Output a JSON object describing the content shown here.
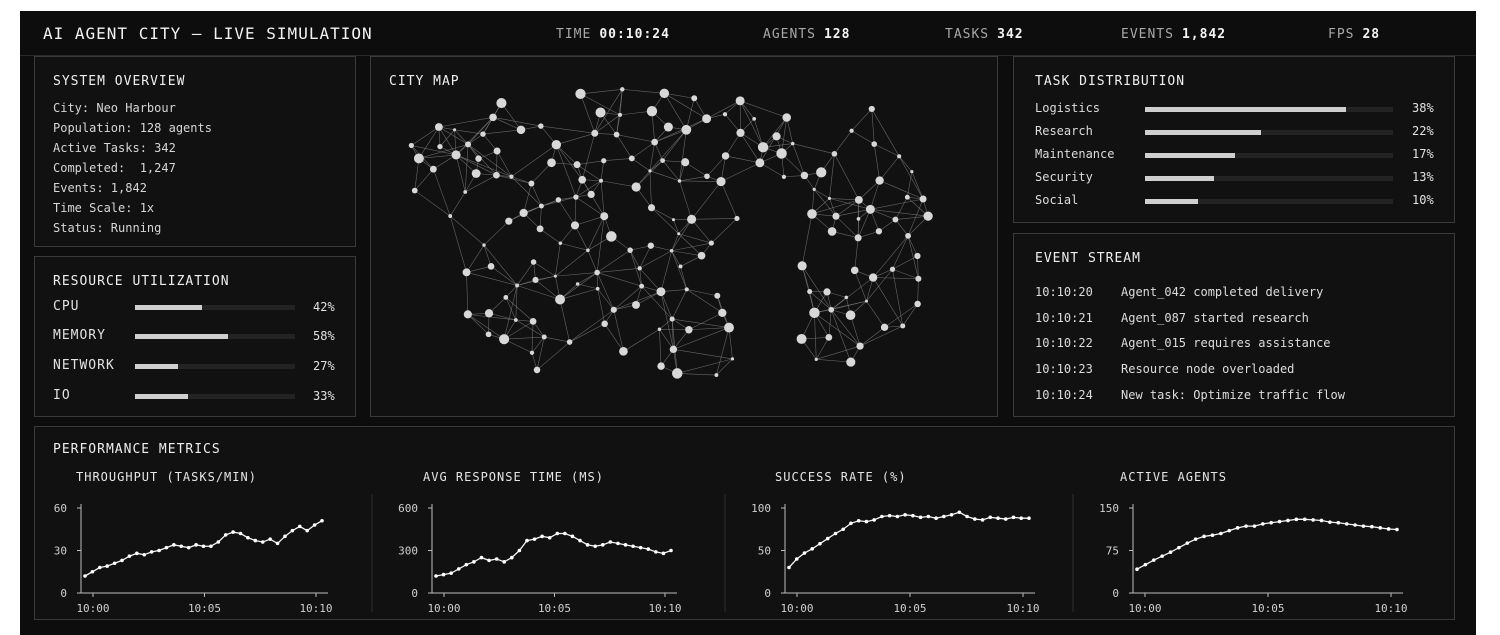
{
  "header": {
    "title": "AI AGENT CITY — LIVE SIMULATION",
    "stats": [
      {
        "label": "TIME",
        "value": "00:10:24"
      },
      {
        "label": "AGENTS",
        "value": "128"
      },
      {
        "label": "TASKS",
        "value": "342"
      },
      {
        "label": "EVENTS",
        "value": "1,842"
      },
      {
        "label": "FPS",
        "value": "28"
      }
    ]
  },
  "system_overview": {
    "title": "SYSTEM OVERVIEW",
    "lines": [
      "City: Neo Harbour",
      "Population: 128 agents",
      "Active Tasks: 342",
      "Completed:  1,247",
      "Events: 1,842",
      "Time Scale: 1x",
      "Status: Running"
    ]
  },
  "resources": {
    "title": "RESOURCE UTILIZATION",
    "items": [
      {
        "label": "CPU",
        "pct": "42%",
        "value": 42
      },
      {
        "label": "MEMORY",
        "pct": "58%",
        "value": 58
      },
      {
        "label": "NETWORK",
        "pct": "27%",
        "value": 27
      },
      {
        "label": "IO",
        "pct": "33%",
        "value": 33
      }
    ]
  },
  "city_map": {
    "title": "CITY MAP"
  },
  "tasks": {
    "title": "TASK DISTRIBUTION",
    "items": [
      {
        "label": "Logistics",
        "pct": "38%",
        "value": 38
      },
      {
        "label": "Research",
        "pct": "22%",
        "value": 22
      },
      {
        "label": "Maintenance",
        "pct": "17%",
        "value": 17
      },
      {
        "label": "Security",
        "pct": "13%",
        "value": 13
      },
      {
        "label": "Social",
        "pct": "10%",
        "value": 10
      }
    ]
  },
  "events": {
    "title": "EVENT STREAM",
    "items": [
      {
        "time": "10:10:20",
        "text": "Agent_042 completed delivery"
      },
      {
        "time": "10:10:21",
        "text": "Agent_087 started research"
      },
      {
        "time": "10:10:22",
        "text": "Agent_015 requires assistance"
      },
      {
        "time": "10:10:23",
        "text": "Resource node overloaded"
      },
      {
        "time": "10:10:24",
        "text": "New task: Optimize traffic flow"
      }
    ]
  },
  "performance": {
    "title": "PERFORMANCE METRICS"
  },
  "colors": {
    "background": "#0d0d0d",
    "panel": "#111111",
    "bar": "#cfcfcf",
    "line": "#f2f2f2"
  },
  "chart_data": [
    {
      "type": "line",
      "title": "THROUGHPUT (TASKS/MIN)",
      "ylim": [
        0,
        60
      ],
      "yticks": [
        "60",
        "30",
        "0"
      ],
      "xticks": [
        "10:00",
        "10:05",
        "10:10"
      ],
      "series": [
        {
          "values": [
            12,
            15,
            18,
            19,
            21,
            23,
            26,
            28,
            27,
            29,
            30,
            32,
            34,
            33,
            32,
            34,
            33,
            33,
            36,
            41,
            43,
            42,
            39,
            37,
            36,
            38,
            35,
            40,
            44,
            47,
            44,
            48,
            51
          ]
        }
      ]
    },
    {
      "type": "line",
      "title": "AVG RESPONSE TIME (MS)",
      "ylim": [
        0,
        600
      ],
      "yticks": [
        "600",
        "300",
        "0"
      ],
      "xticks": [
        "10:00",
        "10:05",
        "10:10"
      ],
      "series": [
        {
          "values": [
            120,
            130,
            140,
            170,
            200,
            220,
            250,
            230,
            240,
            220,
            250,
            300,
            370,
            380,
            400,
            390,
            420,
            420,
            400,
            370,
            340,
            330,
            340,
            360,
            350,
            340,
            330,
            320,
            310,
            290,
            280,
            300
          ]
        }
      ]
    },
    {
      "type": "line",
      "title": "SUCCESS RATE (%)",
      "ylim": [
        0,
        100
      ],
      "yticks": [
        "100",
        "50",
        "0"
      ],
      "xticks": [
        "10:00",
        "10:05",
        "10:10"
      ],
      "series": [
        {
          "values": [
            30,
            40,
            47,
            52,
            58,
            64,
            70,
            75,
            82,
            85,
            84,
            86,
            90,
            91,
            90,
            92,
            91,
            89,
            90,
            88,
            90,
            92,
            95,
            90,
            87,
            86,
            89,
            88,
            87,
            89,
            88,
            88
          ]
        }
      ]
    },
    {
      "type": "line",
      "title": "ACTIVE AGENTS",
      "ylim": [
        0,
        150
      ],
      "yticks": [
        "150",
        "75",
        "0"
      ],
      "xticks": [
        "10:00",
        "10:05",
        "10:10"
      ],
      "series": [
        {
          "values": [
            42,
            50,
            58,
            65,
            72,
            80,
            88,
            95,
            100,
            102,
            105,
            110,
            115,
            118,
            118,
            122,
            124,
            126,
            128,
            130,
            130,
            129,
            128,
            125,
            124,
            122,
            120,
            118,
            117,
            115,
            113,
            112
          ]
        }
      ]
    }
  ]
}
